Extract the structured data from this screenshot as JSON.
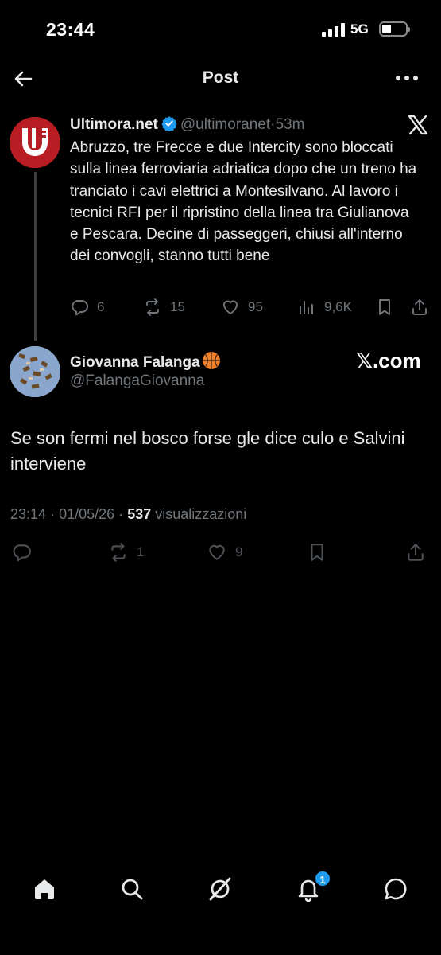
{
  "status_bar": {
    "time": "23:44",
    "network": "5G"
  },
  "header": {
    "title": "Post"
  },
  "quoted_tweet": {
    "name": "Ultimora.net",
    "handle": "@ultimoranet",
    "separator": "·",
    "age": "53m",
    "text": "Abruzzo, tre Frecce e due Intercity sono bloccati sulla linea ferroviaria adriatica dopo che un treno ha tranciato i cavi elettrici a Montesilvano. Al lavoro i tecnici RFI per il ripristino della linea tra Giulianova e Pescara. Decine di passeggeri, chiusi all'interno dei convogli, stanno tutti bene",
    "replies": "6",
    "reposts": "15",
    "likes": "95",
    "views": "9,6K"
  },
  "reply_tweet": {
    "name": "Giovanna Falanga",
    "handle": "@FalangaGiovanna",
    "watermark": "𝕏.com",
    "text": "Se son fermi nel bosco forse gle dice culo e Salvini interviene",
    "time": "23:14",
    "date_sep": "·",
    "date": "01/05/26",
    "views_sep": "·",
    "views_count": "537",
    "views_label": "visualizzazioni",
    "reposts": "1",
    "likes": "9"
  },
  "bottom_nav": {
    "items": [
      "home-icon",
      "search-icon",
      "grok-icon",
      "notifications-icon",
      "messages-icon"
    ],
    "notification_badge": "1"
  },
  "colors": {
    "accent": "#1d9bf0",
    "background": "#000000",
    "secondary_text": "#71767b",
    "brand_red": "#b81d24"
  }
}
